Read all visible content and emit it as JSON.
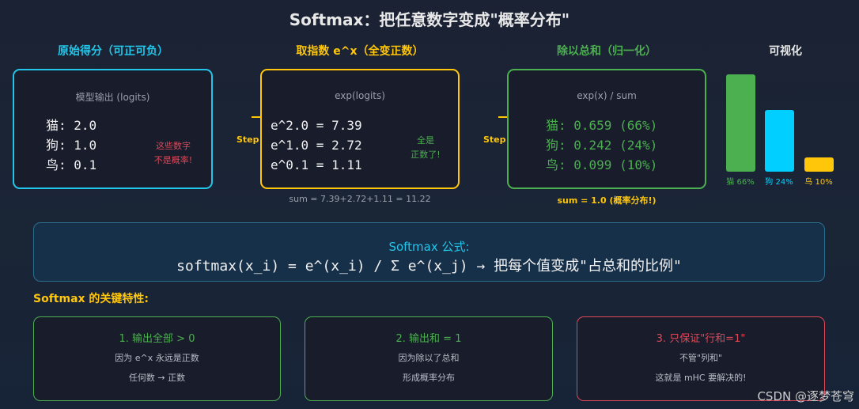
{
  "title": "Softmax：把任意数字变成\"概率分布\"",
  "columns": [
    {
      "heading": "原始得分（可正可负）",
      "box_title": "模型输出 (logits)",
      "lines": [
        "猫: 2.0",
        "狗: 1.0",
        "鸟: 0.1"
      ],
      "note": [
        "这些数字",
        "不是概率!"
      ]
    },
    {
      "heading": "取指数 e^x（全变正数）",
      "box_title": "exp(logits)",
      "lines": [
        "e^2.0 = 7.39",
        "e^1.0 = 2.72",
        "e^0.1 = 1.11"
      ],
      "note": [
        "全是",
        "正数了!"
      ],
      "caption": "sum = 7.39+2.72+1.11 = 11.22"
    },
    {
      "heading": "除以总和（归一化）",
      "box_title": "exp(x) / sum",
      "lines": [
        "猫: 0.659 (66%)",
        "狗: 0.242 (24%)",
        "鸟: 0.099 (10%)"
      ],
      "caption": "sum = 1.0 (概率分布!)"
    }
  ],
  "arrows": [
    "Step",
    "Step"
  ],
  "viz": {
    "heading": "可视化",
    "bars": [
      {
        "label": "猫 66%",
        "value": 0.659,
        "color": "#4caf50"
      },
      {
        "label": "狗 24%",
        "value": 0.242,
        "color": "#00cfff"
      },
      {
        "label": "鸟 10%",
        "value": 0.099,
        "color": "#ffc60a"
      }
    ]
  },
  "formula": {
    "label": "Softmax 公式:",
    "text": "softmax(x_i) = e^(x_i) / Σ e^(x_j) → 把每个值变成\"占总和的比例\""
  },
  "properties": {
    "heading": "Softmax 的关键特性:",
    "items": [
      {
        "title": "1. 输出全部 > 0",
        "lines": [
          "因为 e^x 永远是正数",
          "任何数 → 正数"
        ]
      },
      {
        "title": "2. 输出和 = 1",
        "lines": [
          "因为除以了总和",
          "形成概率分布"
        ]
      },
      {
        "title": "3. 只保证\"行和=1\"",
        "lines": [
          "不管\"列和\"",
          "这就是 mHC 要解决的!"
        ]
      }
    ]
  },
  "watermark": "CSDN @逐梦苍穹",
  "colors": {
    "cyan": "#22c6ea",
    "yellow": "#ffc60a",
    "green": "#4caf50",
    "red": "#e04858"
  }
}
